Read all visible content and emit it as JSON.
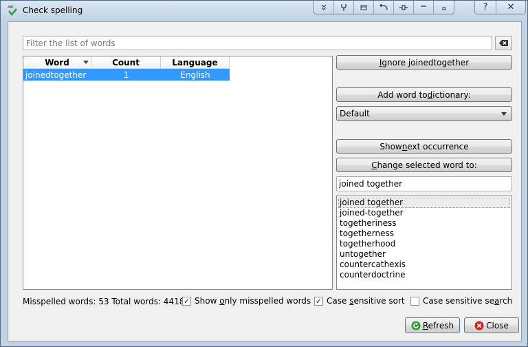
{
  "window": {
    "title": "Check spelling"
  },
  "filter": {
    "placeholder": "Filter the list of words",
    "value": ""
  },
  "table": {
    "columns": [
      "Word",
      "Count",
      "Language"
    ],
    "rows": [
      {
        "word": "joinedtogether",
        "count": "1",
        "language": "English"
      }
    ]
  },
  "buttons": {
    "ignore": {
      "pre": "",
      "key": "I",
      "post": "gnore joinedtogether"
    },
    "add": {
      "pre": "Add word to ",
      "key": "d",
      "post": "ictionary:"
    },
    "dictionary_selected": "Default",
    "show_next": {
      "pre": "Show ",
      "key": "n",
      "post": "ext occurrence"
    },
    "change": {
      "pre": "",
      "key": "C",
      "post": "hange selected word to:"
    },
    "refresh": {
      "pre": "",
      "key": "R",
      "post": "efresh"
    },
    "close": "Close"
  },
  "replacement": {
    "value": "joined together"
  },
  "suggestions": [
    "joined together",
    "joined-together",
    "togetheriness",
    "togetherness",
    "togetherhood",
    "untogether",
    "countercathexis",
    "counterdoctrine"
  ],
  "status": {
    "text": "Misspelled words: 53 Total words: 4418"
  },
  "options": {
    "only_misspelled": {
      "checked": true,
      "pre": "Show ",
      "key": "o",
      "post": "nly misspelled words"
    },
    "case_sort": {
      "checked": true,
      "pre": "Case ",
      "key": "s",
      "post": "ensitive sort"
    },
    "case_search": {
      "checked": false,
      "pre": "Case sensitive se",
      "key": "a",
      "post": "rch"
    }
  },
  "icons": {
    "app": "spellcheck-icon",
    "clear": "clear-text-icon",
    "refresh": "refresh-icon",
    "close": "close-circle-icon"
  },
  "colors": {
    "selection": "#3399ff",
    "close_icon": "#cc2222",
    "refresh_icon": "#2a9d3a"
  }
}
